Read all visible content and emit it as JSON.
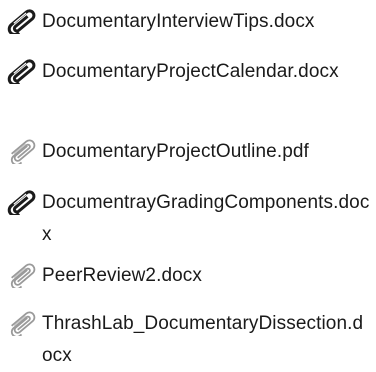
{
  "attachments": [
    {
      "name": "DocumentaryInterviewTips.docx",
      "icon": "paperclip-icon",
      "style": "dark"
    },
    {
      "name": "DocumentaryProjectCalendar.docx",
      "icon": "paperclip-icon",
      "style": "dark"
    },
    {
      "name": "DocumentaryProjectOutline.pdf",
      "icon": "paperclip-icon",
      "style": "light"
    },
    {
      "name": "DocumentrayGradingComponents.docx",
      "icon": "paperclip-icon",
      "style": "dark"
    },
    {
      "name": "PeerReview2.docx",
      "icon": "paperclip-icon",
      "style": "light"
    },
    {
      "name": "ThrashLab_DocumentaryDissection.docx",
      "icon": "paperclip-icon",
      "style": "light"
    }
  ],
  "colors": {
    "text": "#1a1a1a",
    "icon_dark": "#1b1b1b",
    "icon_light": "#9a9a9a",
    "background": "#ffffff"
  }
}
